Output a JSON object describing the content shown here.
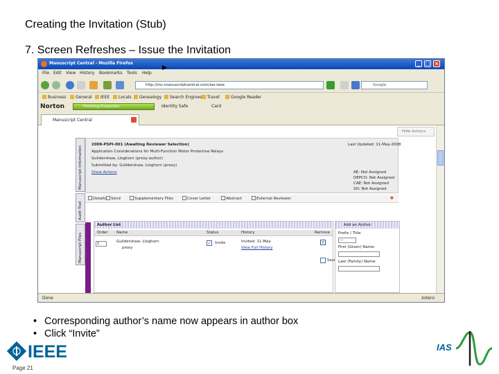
{
  "slide": {
    "title": "Creating the Invitation (Stub)",
    "step_heading": "7.  Screen Refreshes – Issue the Invitation",
    "bullets": [
      "Corresponding author’s name now appears in author box",
      "Click “Invite”"
    ],
    "bullet_glyph": "•",
    "page_number": "Page 21",
    "ieee_logo_text": "IEEE",
    "ias_logo_text": "IAS"
  },
  "browser": {
    "window_title": "Manuscript Central - Mozilla Firefox",
    "window_buttons": [
      "_",
      "□",
      "×"
    ],
    "menu": [
      "File",
      "Edit",
      "View",
      "History",
      "Bookmarks",
      "Tools",
      "Help"
    ],
    "address": "http://mc.manuscriptcentral.com/ias-ieee",
    "search_placeholder": "Google",
    "bookmarks": [
      "Business",
      "General",
      "IEEE",
      "Locals",
      "Genealogy",
      "Search Engines",
      "Travel",
      "Google Reader"
    ],
    "norton": {
      "brand": "Norton",
      "phishing_label": "Phishing Protection",
      "safe_web": "Identity Safe",
      "card": "Card"
    },
    "tab_label": "Manuscript Central",
    "status_text": "Done",
    "zotero_label": "zotero"
  },
  "manuscript": {
    "side_tabs": [
      "Manuscript Information",
      "Audit Trail",
      "Manuscript Files"
    ],
    "id_line": "2008-PSPI-001 (Awaiting Reviewer Selection)",
    "title_line": "Application Considerations for Multi-Function Motor Protective Relays",
    "author_line": "Gulldershaw, Lloghorn (proxy-author)",
    "submitted_line": "Submitted by: Gulldershaw, Lloghorn (proxy)",
    "actions_line": "Show Actions",
    "last_updated": "Last Updated: 11-May-2008",
    "assignments": [
      "AE: Not Assigned",
      "DEPCO: Not Assigned",
      "CAE: Not Assigned",
      "SO: Not Assigned"
    ],
    "corner_label": "Hide Actions",
    "toolbar_items": [
      "Details",
      "Send",
      "Supplementary Files",
      "Cover Letter",
      "Abstract",
      "External Reviewer"
    ]
  },
  "author_list": {
    "heading": "Author List",
    "columns": [
      "Order",
      "Name",
      "Status",
      "History",
      "Remove"
    ],
    "rows": [
      {
        "order": "1",
        "name": "Gulldershaw, Lloghorn",
        "name_sub": "proxy",
        "status_action": "Invite",
        "history_date": "Invited: 11-May",
        "history_link": "View Full History"
      }
    ],
    "save_label": "Save"
  },
  "add_author": {
    "heading": "Add an Author",
    "prefix_label": "Prefix / Title",
    "prefix_value": "---",
    "first_name_label": "First (Given) Name:",
    "last_name_label": "Last (Family) Name:"
  }
}
